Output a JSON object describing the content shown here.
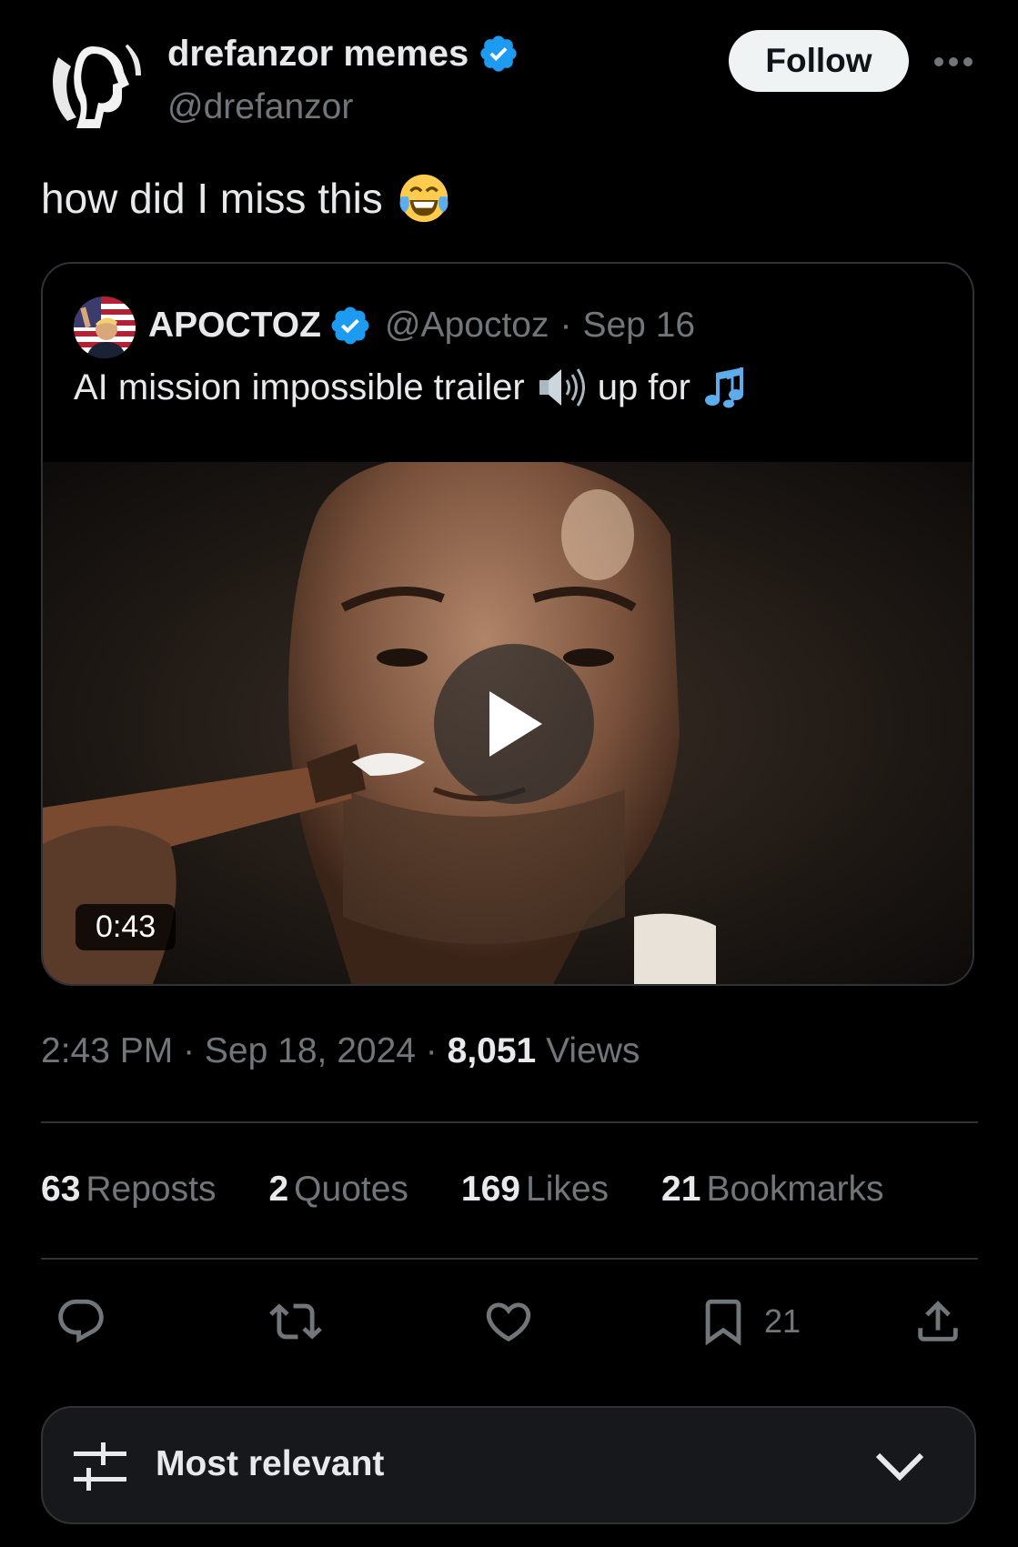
{
  "author": {
    "name": "drefanzor memes",
    "handle": "@drefanzor",
    "verified": true,
    "avatar_icon": "silhouette-profile-avatar"
  },
  "header": {
    "follow_label": "Follow",
    "more_icon": "more-dots-icon"
  },
  "tweet": {
    "text": "how did I miss this",
    "emoji": "face-with-tears-of-joy"
  },
  "quoted_tweet": {
    "name": "APOCTOZ",
    "verified": true,
    "handle": "@Apoctoz",
    "separator": "·",
    "date": "Sep 16",
    "text_part1": "AI mission impossible trailer",
    "speaker_icon": "speaker-high-volume",
    "text_part2": "up for",
    "music_icon": "musical-notes",
    "video": {
      "duration": "0:43",
      "play_icon": "play-icon"
    }
  },
  "meta": {
    "time": "2:43 PM",
    "separator": " · ",
    "date": "Sep 18, 2024",
    "views_count": "8,051",
    "views_label": "Views"
  },
  "stats": [
    {
      "count": "63",
      "label": "Reposts"
    },
    {
      "count": "2",
      "label": "Quotes"
    },
    {
      "count": "169",
      "label": "Likes"
    },
    {
      "count": "21",
      "label": "Bookmarks"
    }
  ],
  "actions": {
    "reply_icon": "reply-icon",
    "repost_icon": "repost-icon",
    "like_icon": "heart-icon",
    "bookmark_icon": "bookmark-icon",
    "bookmark_count": "21",
    "share_icon": "share-icon"
  },
  "sort": {
    "label": "Most relevant",
    "icon": "sliders-icon",
    "chevron": "chevron-down-icon"
  },
  "colors": {
    "background": "#000000",
    "text_primary": "#e7e9ea",
    "text_secondary": "#71767b",
    "border": "#2f3336",
    "verified_blue": "#1d9bf0",
    "follow_bg": "#eff3f4"
  }
}
